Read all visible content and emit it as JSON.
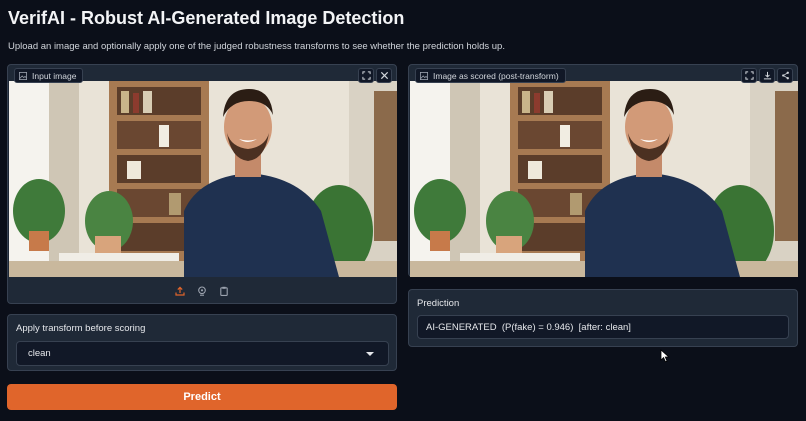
{
  "app": {
    "title": "VerifAI - Robust AI-Generated Image Detection",
    "subtitle": "Upload an image and optionally apply one of the judged robustness transforms to see whether the prediction holds up."
  },
  "input_panel": {
    "label": "Input image",
    "icons": [
      "image-icon",
      "fullscreen-icon",
      "close-icon",
      "upload-icon",
      "webcam-icon",
      "clipboard-icon"
    ]
  },
  "scored_panel": {
    "label": "Image as scored (post-transform)",
    "icons": [
      "image-icon",
      "fullscreen-icon",
      "download-icon",
      "share-icon"
    ]
  },
  "transform": {
    "label": "Apply transform before scoring",
    "selected": "clean"
  },
  "predict": {
    "label": "Predict"
  },
  "prediction": {
    "label": "Prediction",
    "value": "AI-GENERATED  (P(fake) = 0.946)  [after: clean]"
  },
  "colors": {
    "background": "#0b0f19",
    "panel": "#1f2937",
    "accent": "#e0652b"
  }
}
